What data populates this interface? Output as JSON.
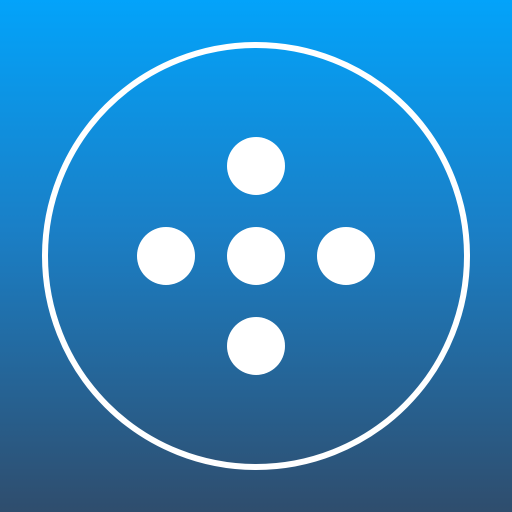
{
  "icon": {
    "name": "app-icon",
    "glyph": "circle-with-five-dots-cross",
    "colors": {
      "gradient_top": "#03a3fa",
      "gradient_mid": "#1a7fc6",
      "gradient_bottom": "#2f4d6d",
      "foreground": "#ffffff"
    }
  }
}
